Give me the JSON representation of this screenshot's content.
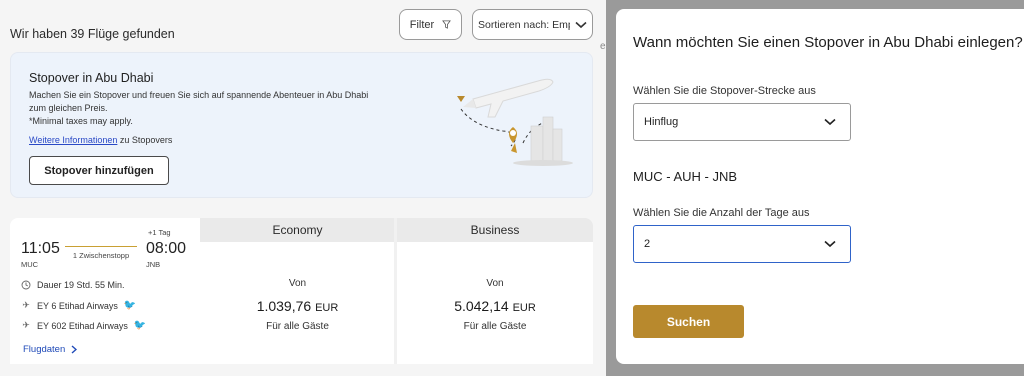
{
  "results": {
    "title": "Wir haben 39 Flüge gefunden",
    "filter_label": "Filter",
    "sort_label": "Sortieren nach: Empf..."
  },
  "stray_text": "e",
  "promo": {
    "title": "Stopover in Abu Dhabi",
    "description": "Machen Sie ein Stopover und freuen Sie sich auf spannende Abenteuer in Abu Dhabi zum gleichen Preis.",
    "note": "*Minimal taxes may apply.",
    "link_text": "Weitere Informationen",
    "link_suffix": " zu Stopovers",
    "button_label": "Stopover hinzufügen"
  },
  "flight": {
    "departure_time": "11:05",
    "departure_code": "MUC",
    "arrival_time": "08:00",
    "arrival_code": "JNB",
    "day_offset": "+1 Tag",
    "stops": "1 Zwischenstopp",
    "duration": "Dauer 19 Std. 55 Min.",
    "segments": [
      "EY 6 Etihad Airways",
      "EY 602 Etihad Airways"
    ],
    "details_link": "Flugdaten",
    "fares": [
      {
        "class": "Economy",
        "from": "Von",
        "price": "1.039,76",
        "currency": "EUR",
        "note": "Für alle Gäste"
      },
      {
        "class": "Business",
        "from": "Von",
        "price": "5.042,14",
        "currency": "EUR",
        "note": "Für alle Gäste"
      }
    ]
  },
  "modal": {
    "title": "Wann möchten Sie einen Stopover in Abu Dhabi einlegen?",
    "route_label": "Wählen Sie die Stopover-Strecke aus",
    "route_value": "Hinflug",
    "route": "MUC - AUH - JNB",
    "days_label": "Wählen Sie die Anzahl der Tage aus",
    "days_value": "2",
    "search_button": "Suchen"
  },
  "colors": {
    "accent_gold": "#b8892d",
    "link_blue": "#1f4ab8",
    "focus_blue": "#2f63c9"
  },
  "icons": [
    "funnel-icon",
    "chevron-down-icon",
    "clock-icon",
    "plane-icon",
    "chevron-right-icon",
    "etihad-logo-icon"
  ]
}
